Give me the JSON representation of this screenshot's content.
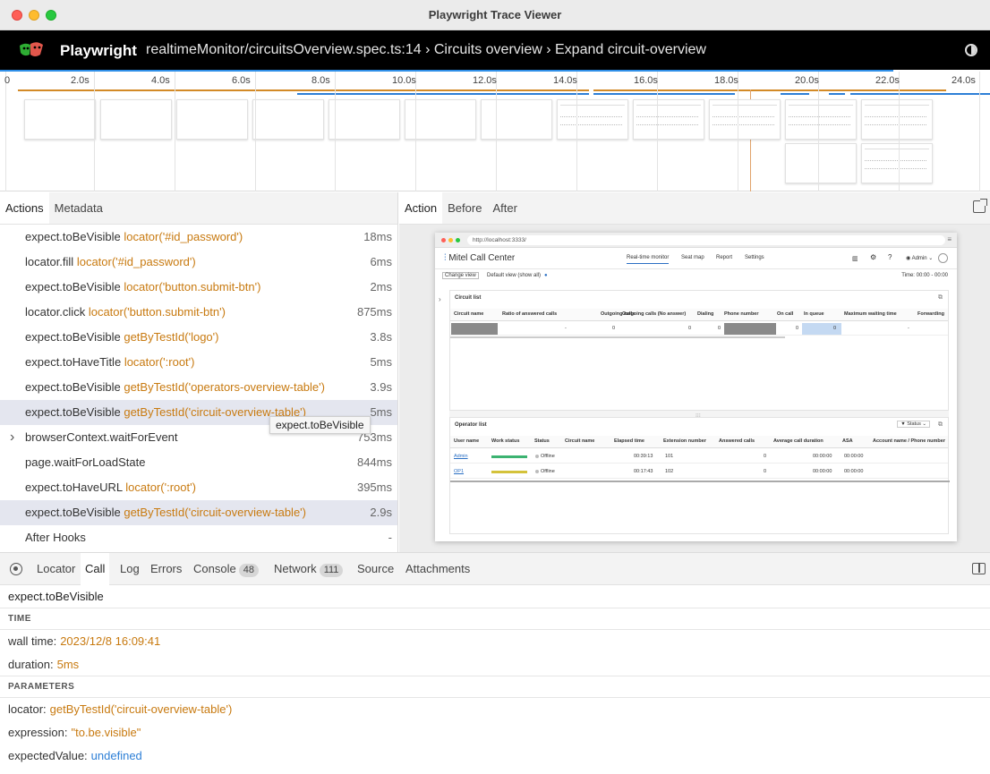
{
  "window": {
    "title": "Playwright Trace Viewer"
  },
  "header": {
    "brand": "Playwright",
    "path": "realtimeMonitor/circuitsOverview.spec.ts:14 › Circuits overview › Expand circuit-overview"
  },
  "timeline": {
    "ticks": [
      "0",
      "2.0s",
      "4.0s",
      "6.0s",
      "8.0s",
      "10.0s",
      "12.0s",
      "14.0s",
      "16.0s",
      "18.0s",
      "20.0s",
      "22.0s",
      "24.0s"
    ]
  },
  "left_tabs": [
    "Actions",
    "Metadata"
  ],
  "actions": [
    {
      "name": "expect.toBeVisible",
      "selector": "locator('#id_password')",
      "duration": "18ms",
      "selected": false,
      "expandable": false
    },
    {
      "name": "locator.fill",
      "selector": "locator('#id_password')",
      "duration": "6ms",
      "selected": false,
      "expandable": false
    },
    {
      "name": "expect.toBeVisible",
      "selector": "locator('button.submit-btn')",
      "duration": "2ms",
      "selected": false,
      "expandable": false
    },
    {
      "name": "locator.click",
      "selector": "locator('button.submit-btn')",
      "duration": "875ms",
      "selected": false,
      "expandable": false
    },
    {
      "name": "expect.toBeVisible",
      "selector": "getByTestId('logo')",
      "duration": "3.8s",
      "selected": false,
      "expandable": false
    },
    {
      "name": "expect.toHaveTitle",
      "selector": "locator(':root')",
      "duration": "5ms",
      "selected": false,
      "expandable": false
    },
    {
      "name": "expect.toBeVisible",
      "selector": "getByTestId('operators-overview-table')",
      "duration": "3.9s",
      "selected": false,
      "expandable": false
    },
    {
      "name": "expect.toBeVisible",
      "selector": "getByTestId('circuit-overview-table')",
      "duration": "5ms",
      "selected": true,
      "expandable": false
    },
    {
      "name": "browserContext.waitForEvent",
      "selector": "",
      "duration": "753ms",
      "selected": false,
      "expandable": true
    },
    {
      "name": "page.waitForLoadState",
      "selector": "",
      "duration": "844ms",
      "selected": false,
      "expandable": false
    },
    {
      "name": "expect.toHaveURL",
      "selector": "locator(':root')",
      "duration": "395ms",
      "selected": false,
      "expandable": false
    },
    {
      "name": "expect.toBeVisible",
      "selector": "getByTestId('circuit-overview-table')",
      "duration": "2.9s",
      "selected": true,
      "expandable": false
    },
    {
      "name": "After Hooks",
      "selector": "",
      "duration": "-",
      "selected": false,
      "expandable": false
    }
  ],
  "tooltip": "expect.toBeVisible",
  "right_tabs": [
    "Action",
    "Before",
    "After"
  ],
  "snapshot": {
    "url": "http://localhost:3333/",
    "logo_a": "Mitel",
    "logo_b": " Call Center",
    "nav": [
      "Real-time monitor",
      "Seat map",
      "Report",
      "Settings"
    ],
    "admin": "Admin",
    "change_view": "Change view",
    "default_view": "Default view (show all)",
    "time": "Time: 00:00 - 00:00",
    "circuit_list": {
      "title": "Circuit list",
      "headers": [
        "Circuit name",
        "Ratio of answered calls",
        "Outgoing calls",
        "Outgoing calls (No answer)",
        "Dialing",
        "Phone number",
        "On call",
        "In queue",
        "Maximum waiting time",
        "Forwarding"
      ],
      "row": [
        "",
        "-",
        "0",
        "0",
        "0",
        "",
        "0",
        "0",
        "-",
        ""
      ]
    },
    "operator_list": {
      "title": "Operator list",
      "status_filter": "Status",
      "headers": [
        "User name",
        "Work status",
        "Status",
        "Circuit name",
        "Elapsed time",
        "Extension number",
        "Answered calls",
        "Average call duration",
        "ASA",
        "Account name / Phone number"
      ],
      "rows": [
        {
          "user": "Admin",
          "status": "Offline",
          "elapsed": "00:39:13",
          "ext": "101",
          "answered": "0",
          "avg": "00:00:00",
          "asa": "00:00:00",
          "bar_color": "#3cb371"
        },
        {
          "user": "OP1",
          "status": "Offline",
          "elapsed": "00:17:43",
          "ext": "102",
          "answered": "0",
          "avg": "00:00:00",
          "asa": "00:00:00",
          "bar_color": "#d4c23a"
        }
      ]
    }
  },
  "bottom_tabs": [
    {
      "label": "Locator",
      "badge": ""
    },
    {
      "label": "Call",
      "badge": ""
    },
    {
      "label": "Log",
      "badge": ""
    },
    {
      "label": "Errors",
      "badge": ""
    },
    {
      "label": "Console",
      "badge": "48"
    },
    {
      "label": "Network",
      "badge": "111"
    },
    {
      "label": "Source",
      "badge": ""
    },
    {
      "label": "Attachments",
      "badge": ""
    }
  ],
  "call": {
    "title": "expect.toBeVisible",
    "time_heading": "TIME",
    "wall_time_label": "wall time:",
    "wall_time": "2023/12/8 16:09:41",
    "duration_label": "duration:",
    "duration": "5ms",
    "params_heading": "PARAMETERS",
    "locator_label": "locator:",
    "locator": "getByTestId('circuit-overview-table')",
    "expression_label": "expression:",
    "expression": "\"to.be.visible\"",
    "expected_label": "expectedValue:",
    "expected": "undefined"
  },
  "colors": {
    "accent_orange": "#c87a10",
    "accent_blue": "#2d7fd6",
    "selected_row": "#e4e6ef"
  }
}
